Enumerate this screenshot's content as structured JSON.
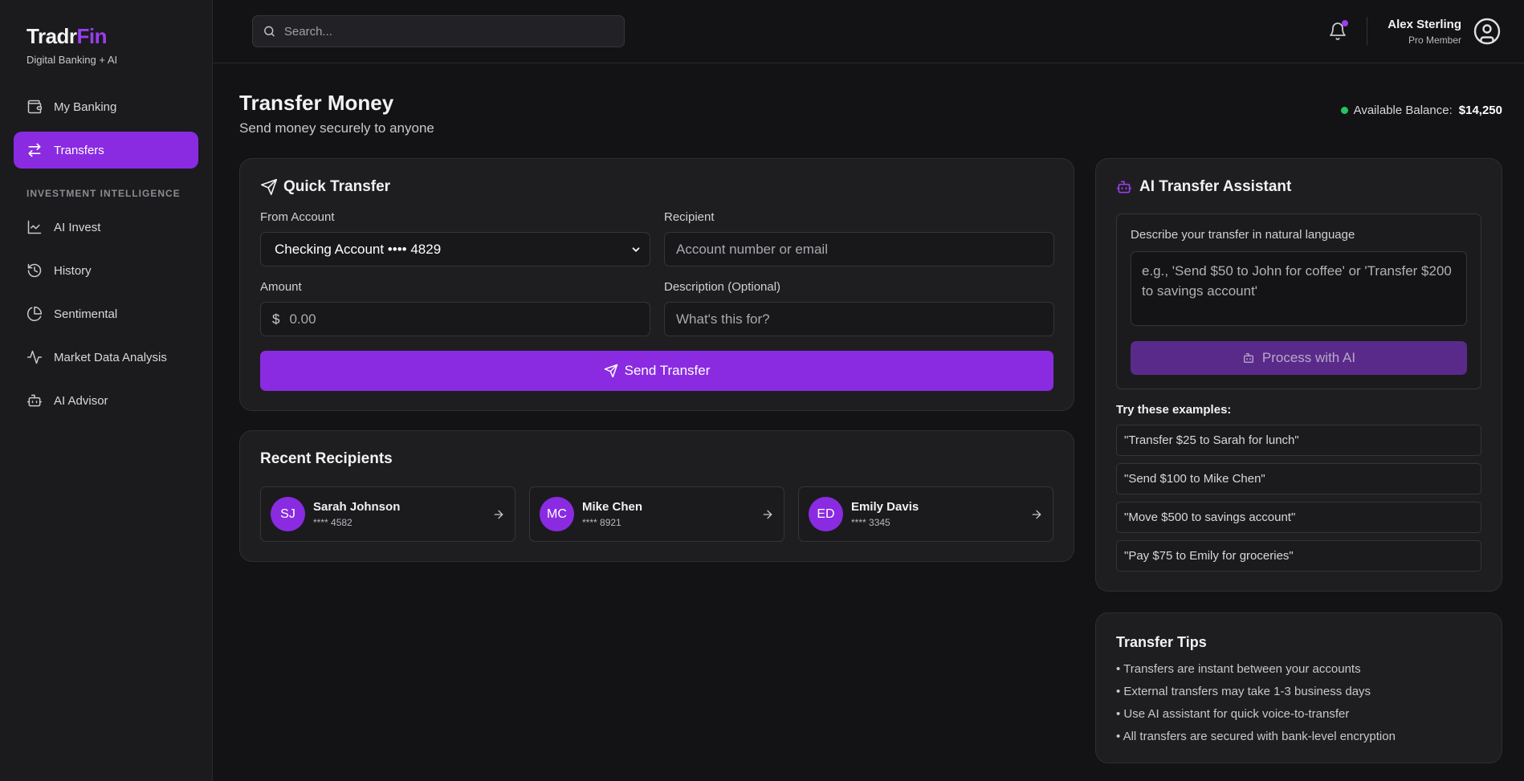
{
  "brand": {
    "name_main": "Tradr",
    "name_accent": "Fin",
    "tagline": "Digital Banking + AI"
  },
  "sidebar": {
    "items_top": [
      {
        "label": "My Banking",
        "icon": "wallet-icon"
      },
      {
        "label": "Transfers",
        "icon": "arrows-exchange-icon",
        "active": true
      }
    ],
    "section_label": "INVESTMENT INTELLIGENCE",
    "items_bottom": [
      {
        "label": "AI Invest",
        "icon": "chart-line-icon"
      },
      {
        "label": "History",
        "icon": "history-icon"
      },
      {
        "label": "Sentimental",
        "icon": "pie-chart-icon"
      },
      {
        "label": "Market Data Analysis",
        "icon": "activity-icon"
      },
      {
        "label": "AI Advisor",
        "icon": "bot-icon"
      }
    ]
  },
  "topbar": {
    "search_placeholder": "Search...",
    "user_name": "Alex Sterling",
    "user_role": "Pro Member"
  },
  "page": {
    "title": "Transfer Money",
    "subtitle": "Send money securely to anyone",
    "balance_label": "Available Balance:",
    "balance_value": "$14,250"
  },
  "quick_transfer": {
    "title": "Quick Transfer",
    "from_label": "From Account",
    "from_value": "Checking Account •••• 4829",
    "recipient_label": "Recipient",
    "recipient_placeholder": "Account number or email",
    "amount_label": "Amount",
    "currency_symbol": "$",
    "amount_placeholder": "0.00",
    "description_label": "Description (Optional)",
    "description_placeholder": "What's this for?",
    "send_label": "Send Transfer"
  },
  "recent": {
    "title": "Recent Recipients",
    "items": [
      {
        "initials": "SJ",
        "name": "Sarah Johnson",
        "account": "**** 4582"
      },
      {
        "initials": "MC",
        "name": "Mike Chen",
        "account": "**** 8921"
      },
      {
        "initials": "ED",
        "name": "Emily Davis",
        "account": "**** 3345"
      }
    ]
  },
  "ai": {
    "title": "AI Transfer Assistant",
    "label": "Describe your transfer in natural language",
    "placeholder": "e.g., 'Send $50 to John for coffee' or 'Transfer $200 to savings account'",
    "button": "Process with AI",
    "try_label": "Try these examples:",
    "examples": [
      "\"Transfer $25 to Sarah for lunch\"",
      "\"Send $100 to Mike Chen\"",
      "\"Move $500 to savings account\"",
      "\"Pay $75 to Emily for groceries\""
    ]
  },
  "tips": {
    "title": "Transfer Tips",
    "items": [
      "• Transfers are instant between your accounts",
      "• External transfers may take 1-3 business days",
      "• Use AI assistant for quick voice-to-transfer",
      "• All transfers are secured with bank-level encryption"
    ]
  },
  "colors": {
    "accent": "#8a2be2",
    "background": "#131315",
    "card": "#1e1e21",
    "success": "#22c55e"
  }
}
